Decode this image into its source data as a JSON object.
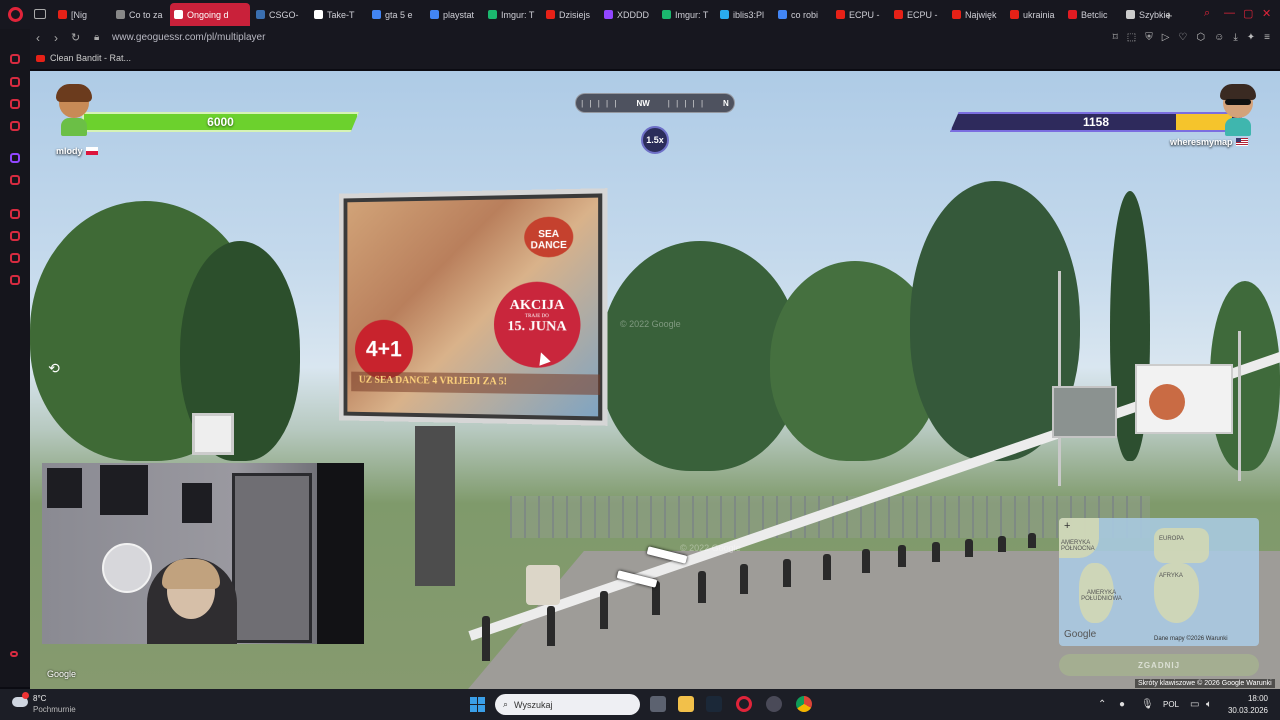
{
  "browser": {
    "tabs": [
      {
        "label": "[Nig",
        "color": "#e62117"
      },
      {
        "label": "Co to za",
        "color": "#888888"
      },
      {
        "label": "Ongoing d",
        "color": "#ffffff",
        "active": true
      },
      {
        "label": "CSGO-",
        "color": "#3a6fb0"
      },
      {
        "label": "Take-T",
        "color": "#ffffff"
      },
      {
        "label": "gta 5 e",
        "color": "#4285f4"
      },
      {
        "label": "playstat",
        "color": "#4285f4"
      },
      {
        "label": "Imgur: T",
        "color": "#1bb76e"
      },
      {
        "label": "Dzisiejs",
        "color": "#e62117"
      },
      {
        "label": "XDDDD",
        "color": "#9146ff"
      },
      {
        "label": "Imgur: T",
        "color": "#1bb76e"
      },
      {
        "label": "iblis3:Pl",
        "color": "#2aabee"
      },
      {
        "label": "co robi",
        "color": "#4285f4"
      },
      {
        "label": "ECPU -",
        "color": "#e62117"
      },
      {
        "label": "ECPU -",
        "color": "#e62117"
      },
      {
        "label": "Najwięk",
        "color": "#e62117"
      },
      {
        "label": "ukrainia",
        "color": "#e62117"
      },
      {
        "label": "Betclic",
        "color": "#e11b22"
      },
      {
        "label": "Szybkie",
        "color": "#cccccc"
      }
    ],
    "url": "www.geoguessr.com/pl/multiplayer",
    "bookmark": "Clean Bandit - Rat..."
  },
  "game": {
    "player_left": {
      "name": "mlody",
      "score": "6000",
      "bar_color": "#6cd12d"
    },
    "player_right": {
      "name": "wheresmymap",
      "score": "1158",
      "bar_color": "#2e2a5c"
    },
    "compass": {
      "left": "NW",
      "right": "N"
    },
    "multiplier": "1.5x",
    "billboard": {
      "badge": "4+1",
      "akcija_title": "AKCIJA",
      "akcija_sub": "TRAJE DO",
      "akcija_date": "15. JUNA",
      "brand": "SEA DANCE",
      "strip": "UZ SEA DANCE 4 VRIJEDI ZA 5!"
    },
    "watermark": "© 2022 Google",
    "minimap": {
      "labels": [
        "EUROPA",
        "AFRYKA",
        "AMERYKA POŁUDNIOWA",
        "AMERYKA PÓŁNOCNA"
      ],
      "footer": "Dane mapy ©2026  Warunki",
      "google": "Google"
    },
    "guess_button": "ZGADNIJ",
    "google_logo": "Google",
    "footer": "Skróty klawiszowe  © 2026 Google  Warunki"
  },
  "taskbar": {
    "weather_temp": "8°C",
    "weather_cond": "Pochmurnie",
    "search_placeholder": "Wyszukaj",
    "lang": "POL",
    "time": "18:00",
    "date": "30.03.2026"
  }
}
